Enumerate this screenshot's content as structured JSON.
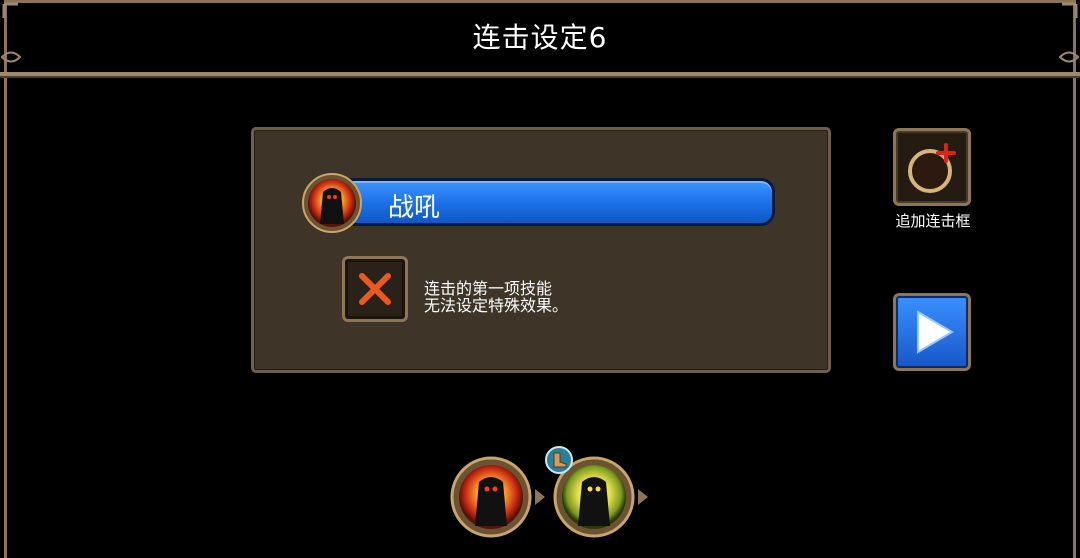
{
  "header": {
    "title": "连击设定6"
  },
  "panel": {
    "skill_name": "战吼",
    "info_line1": "连击的第一项技能",
    "info_line2": "无法设定特殊效果。"
  },
  "side": {
    "add_label": "追加连击框"
  },
  "combo": {
    "slots": [
      "roar-skill-icon",
      "holy-skill-icon"
    ]
  },
  "colors": {
    "bar_blue": "#1b6fe6",
    "frame_gold": "#a08968",
    "panel_brown": "#3e3528",
    "x_red": "#e85a20"
  }
}
